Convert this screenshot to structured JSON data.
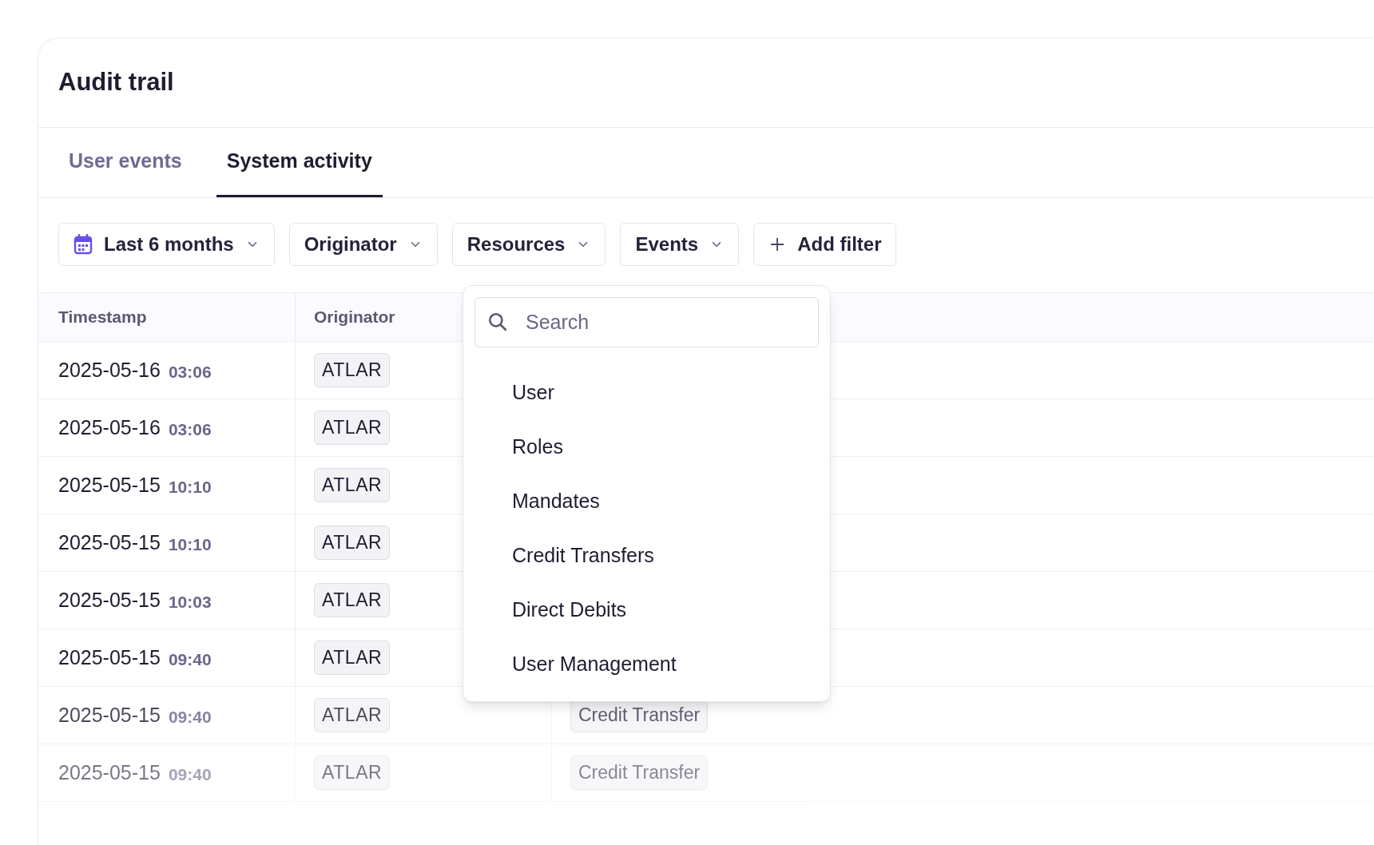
{
  "title": "Audit trail",
  "tabs": [
    {
      "label": "User events",
      "selected": false
    },
    {
      "label": "System activity",
      "selected": true
    }
  ],
  "filters": [
    {
      "kind": "date",
      "label": "Last 6 months"
    },
    {
      "kind": "dropdown",
      "label": "Originator"
    },
    {
      "kind": "dropdown",
      "label": "Resources"
    },
    {
      "kind": "dropdown",
      "label": "Events"
    },
    {
      "kind": "add",
      "label": "Add filter"
    }
  ],
  "table": {
    "columns": [
      "Timestamp",
      "Originator"
    ],
    "rows": [
      {
        "date": "2025-05-16",
        "time": "03:06",
        "originator": "ATLAR"
      },
      {
        "date": "2025-05-16",
        "time": "03:06",
        "originator": "ATLAR"
      },
      {
        "date": "2025-05-15",
        "time": "10:10",
        "originator": "ATLAR"
      },
      {
        "date": "2025-05-15",
        "time": "10:10",
        "originator": "ATLAR"
      },
      {
        "date": "2025-05-15",
        "time": "10:03",
        "originator": "ATLAR"
      },
      {
        "date": "2025-05-15",
        "time": "09:40",
        "originator": "ATLAR"
      },
      {
        "date": "2025-05-15",
        "time": "09:40",
        "originator": "ATLAR",
        "resource": "Credit Transfer"
      },
      {
        "date": "2025-05-15",
        "time": "09:40",
        "originator": "ATLAR",
        "resource": "Credit Transfer"
      }
    ]
  },
  "resources_menu": {
    "search": {
      "placeholder": "Search"
    },
    "items": [
      "User",
      "Roles",
      "Mandates",
      "Credit Transfers",
      "Direct Debits",
      "User Management"
    ]
  }
}
